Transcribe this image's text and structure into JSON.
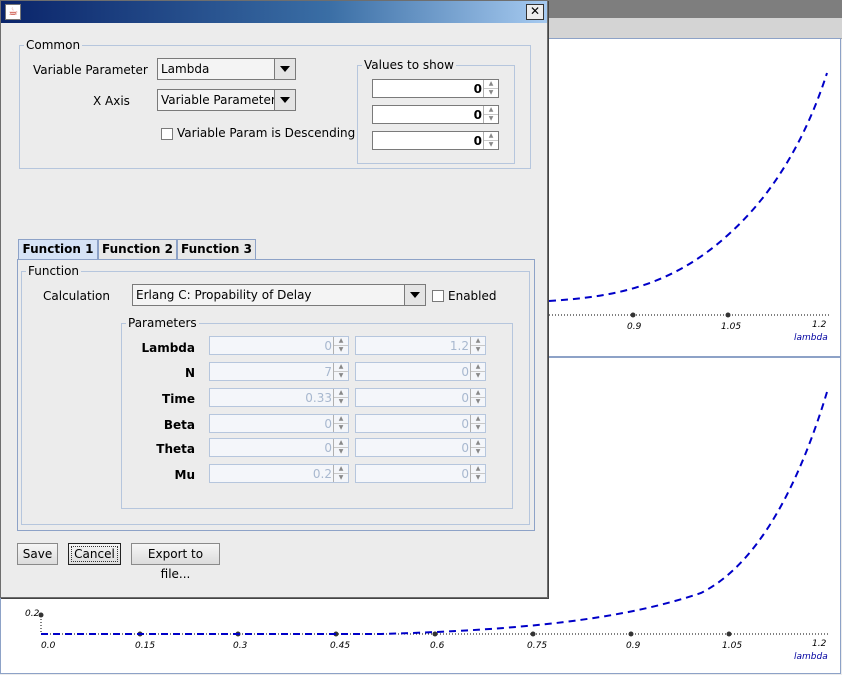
{
  "dialog": {
    "title": "",
    "close_label": "✕",
    "common": {
      "title": "Common",
      "variable_parameter_label": "Variable Parameter",
      "variable_parameter_value": "Lambda",
      "x_axis_label": "X Axis",
      "x_axis_value": "Variable Parameter",
      "descending_label": "Variable Param is Descending",
      "values_to_show": {
        "title": "Values to show",
        "values": [
          "0",
          "0",
          "0"
        ]
      }
    },
    "tabs": [
      {
        "label": "Function 1"
      },
      {
        "label": "Function 2"
      },
      {
        "label": "Function 3"
      }
    ],
    "function": {
      "title": "Function",
      "calculation_label": "Calculation",
      "calculation_value": "Erlang C: Propability of Delay",
      "enabled_label": "Enabled",
      "parameters": {
        "title": "Parameters",
        "rows": [
          {
            "label": "Lambda",
            "from": "0",
            "to": "1.2"
          },
          {
            "label": "N",
            "from": "7",
            "to": "0"
          },
          {
            "label": "Time",
            "from": "0.33",
            "to": "0"
          },
          {
            "label": "Beta",
            "from": "0",
            "to": "0"
          },
          {
            "label": "Theta",
            "from": "0",
            "to": "0"
          },
          {
            "label": "Mu",
            "from": "0.2",
            "to": "0"
          }
        ]
      }
    },
    "buttons": {
      "save": "Save",
      "cancel": "Cancel",
      "export": "Export to file..."
    }
  },
  "plots": {
    "top_x_ticks": [
      "0.9",
      "1.05",
      "1.2"
    ],
    "top_xlabel": "lambda",
    "bottom_x_ticks": [
      "0.0",
      "0.15",
      "0.3",
      "0.45",
      "0.6",
      "0.75",
      "0.9",
      "1.05",
      "1.2"
    ],
    "bottom_xlabel": "lambda",
    "bottom_y_tick": "0.2",
    "series_color": "#0000c8"
  }
}
